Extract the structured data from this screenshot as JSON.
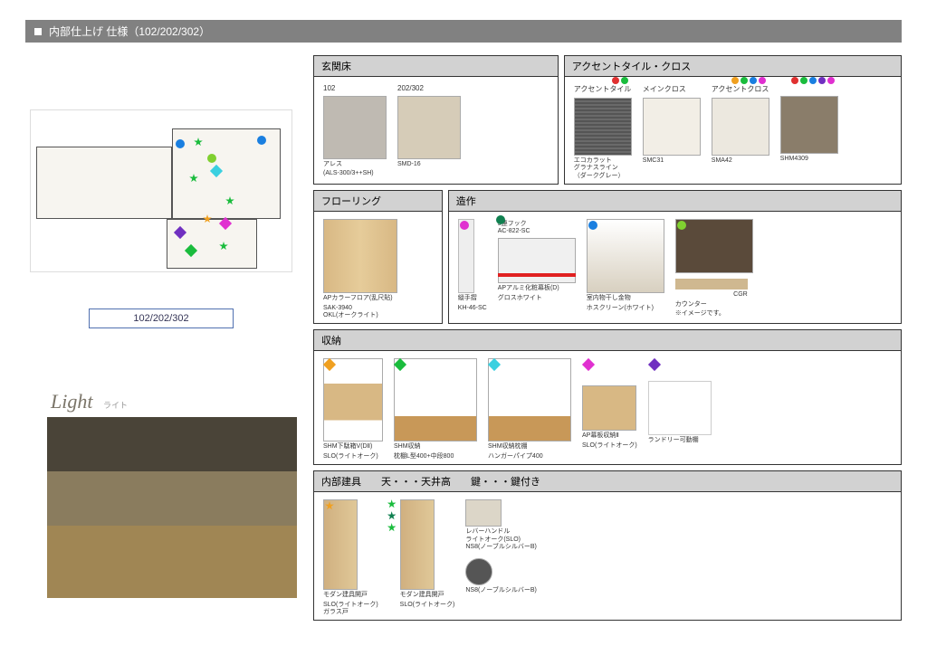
{
  "titlebar": {
    "title": "内部仕上げ  仕様（102/202/302）"
  },
  "roombox": "102/202/302",
  "light": {
    "label": "Light",
    "sub": "ライト"
  },
  "sections": {
    "genkan": {
      "title": "玄関床",
      "items": [
        {
          "top": "102",
          "name": "アレス",
          "sub": "(ALS-300/3++SH)"
        },
        {
          "top": "202/302",
          "name": "SMD-16",
          "sub": ""
        }
      ]
    },
    "accent": {
      "title": "アクセントタイル・クロス",
      "items": [
        {
          "top": "アクセントタイル",
          "name": "エコカラット\nグラナスライン\n（ダークグレー）"
        },
        {
          "top": "メインクロス",
          "name": "SMC31"
        },
        {
          "top": "アクセントクロス",
          "name": "SMA42"
        },
        {
          "top": "",
          "name": "SHM4309"
        }
      ]
    },
    "flooring": {
      "title": "フローリング",
      "items": [
        {
          "name": "APカラーフロア(乱尺貼)",
          "sub": "SAK-3940\nOKL(オークライト)"
        }
      ]
    },
    "zousaku": {
      "title": "造作",
      "items": [
        {
          "name": "縦手摺",
          "sub": "KH-46-SC"
        },
        {
          "top": "3連フック\nAC-822-SC",
          "name": "APアルミ化粧幕板(D)",
          "sub": "グロスホワイト"
        },
        {
          "name": "室内物干し金物",
          "sub": "ホスクリーン(ホワイト)"
        },
        {
          "name": "カウンター",
          "sub": "※イメージです。",
          "extra": "CGR"
        }
      ]
    },
    "shuno": {
      "title": "収納",
      "items": [
        {
          "name": "SHM下駄箱V(DⅡ)",
          "sub": "SLO(ライトオーク)"
        },
        {
          "name": "SHM収納",
          "sub": "枕棚L型400+中段800"
        },
        {
          "name": "SHM収納枕棚",
          "sub": "ハンガーパイプ400"
        },
        {
          "name": "AP幕板収納Ⅱ",
          "sub": "SLO(ライトオーク)"
        },
        {
          "name": "ランドリー可動棚",
          "sub": ""
        }
      ]
    },
    "tategu": {
      "title": "内部建具　　天・・・天井高　　鍵・・・鍵付き",
      "items": [
        {
          "name": "モダン建具開戸",
          "sub": "SLO(ライトオーク)\nガラス戸"
        },
        {
          "name": "モダン建具開戸",
          "sub": "SLO(ライトオーク)"
        },
        {
          "name": "レバーハンドル\nライトオーク(SLO)\nNS8(ノーブルシルバーB)",
          "sub": ""
        },
        {
          "name": "NS8(ノーブルシルバーB)",
          "sub": ""
        }
      ]
    }
  }
}
